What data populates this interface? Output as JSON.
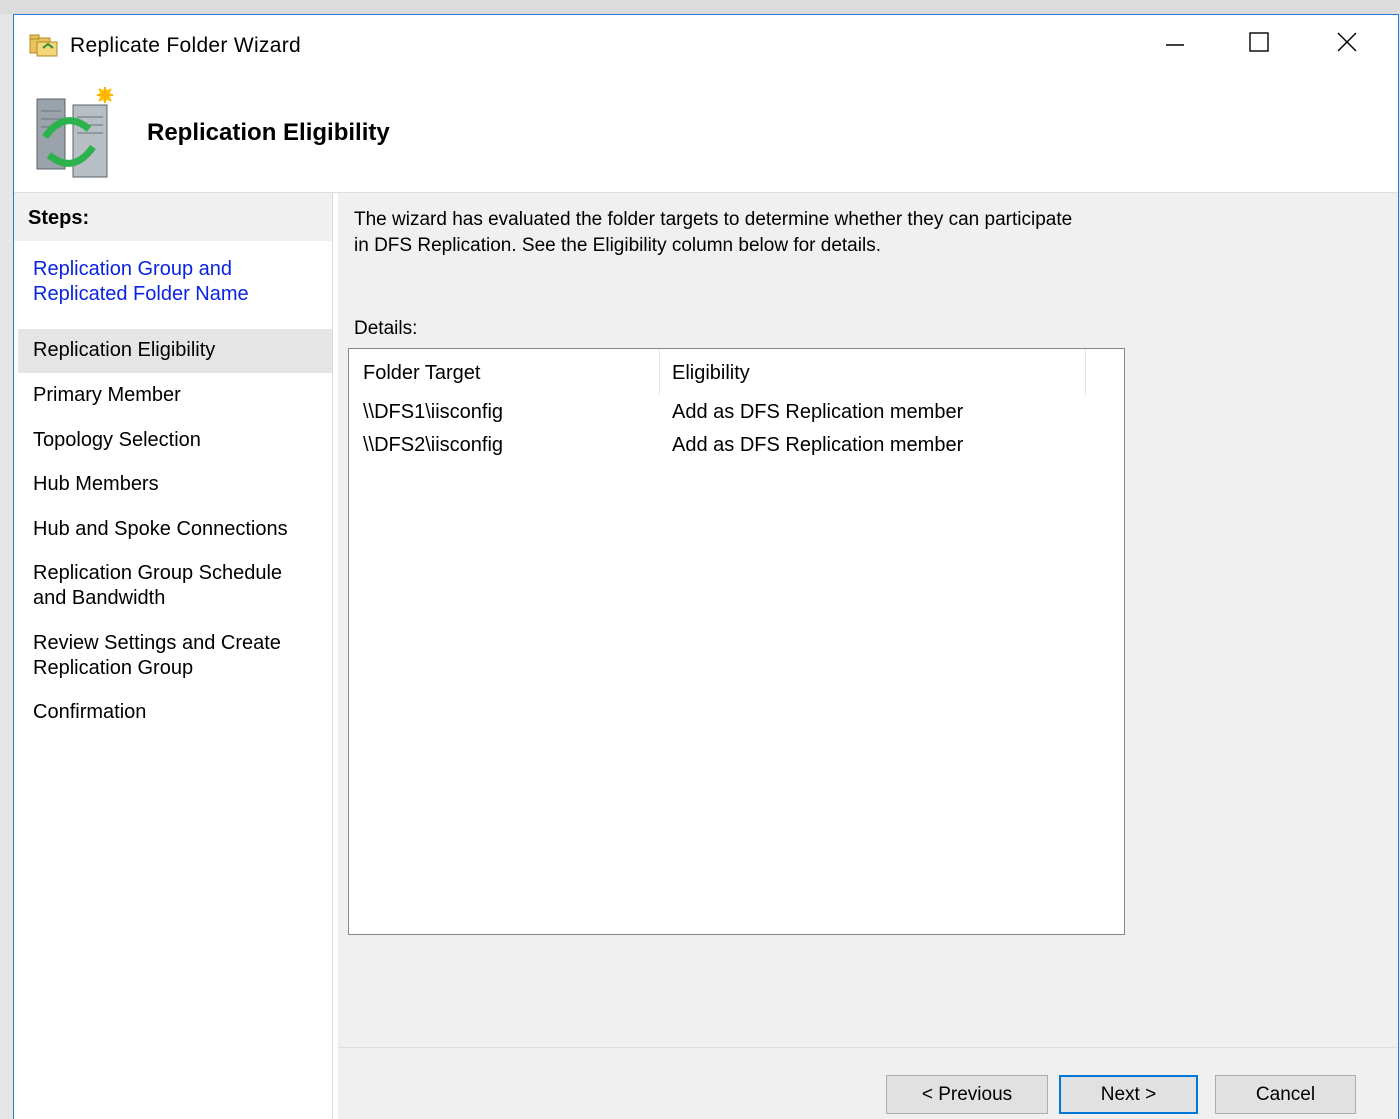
{
  "window": {
    "title": "Replicate Folder Wizard",
    "icon": "replicate-folder-icon",
    "controls": [
      "minimize-icon",
      "maximize-icon",
      "close-icon"
    ]
  },
  "header": {
    "title": "Replication Eligibility",
    "icon": "replication-servers-icon"
  },
  "steps": {
    "heading": "Steps:",
    "items": [
      {
        "label": "Replication Group and Replicated Folder Name",
        "state": "completed"
      },
      {
        "label": "Replication Eligibility",
        "state": "current"
      },
      {
        "label": "Primary Member",
        "state": "pending"
      },
      {
        "label": "Topology Selection",
        "state": "pending"
      },
      {
        "label": "Hub Members",
        "state": "pending"
      },
      {
        "label": "Hub and Spoke Connections",
        "state": "pending"
      },
      {
        "label": "Replication Group Schedule and Bandwidth",
        "state": "pending"
      },
      {
        "label": "Review Settings and Create Replication Group",
        "state": "pending"
      },
      {
        "label": "Confirmation",
        "state": "pending"
      }
    ]
  },
  "main": {
    "description": "The wizard has evaluated the folder targets to determine whether they can participate in DFS Replication. See the Eligibility column below for details.",
    "details_label": "Details:",
    "table": {
      "columns": [
        "Folder Target",
        "Eligibility"
      ],
      "rows": [
        {
          "target": "\\\\DFS1\\iisconfig",
          "eligibility": "Add as DFS Replication member"
        },
        {
          "target": "\\\\DFS2\\iisconfig",
          "eligibility": "Add as DFS Replication member"
        }
      ]
    }
  },
  "buttons": {
    "previous": "< Previous",
    "next": "Next >",
    "cancel": "Cancel"
  },
  "colors": {
    "link_step": "#0a24e0",
    "window_border": "#2b79d8",
    "default_button_border": "#0078d7"
  }
}
